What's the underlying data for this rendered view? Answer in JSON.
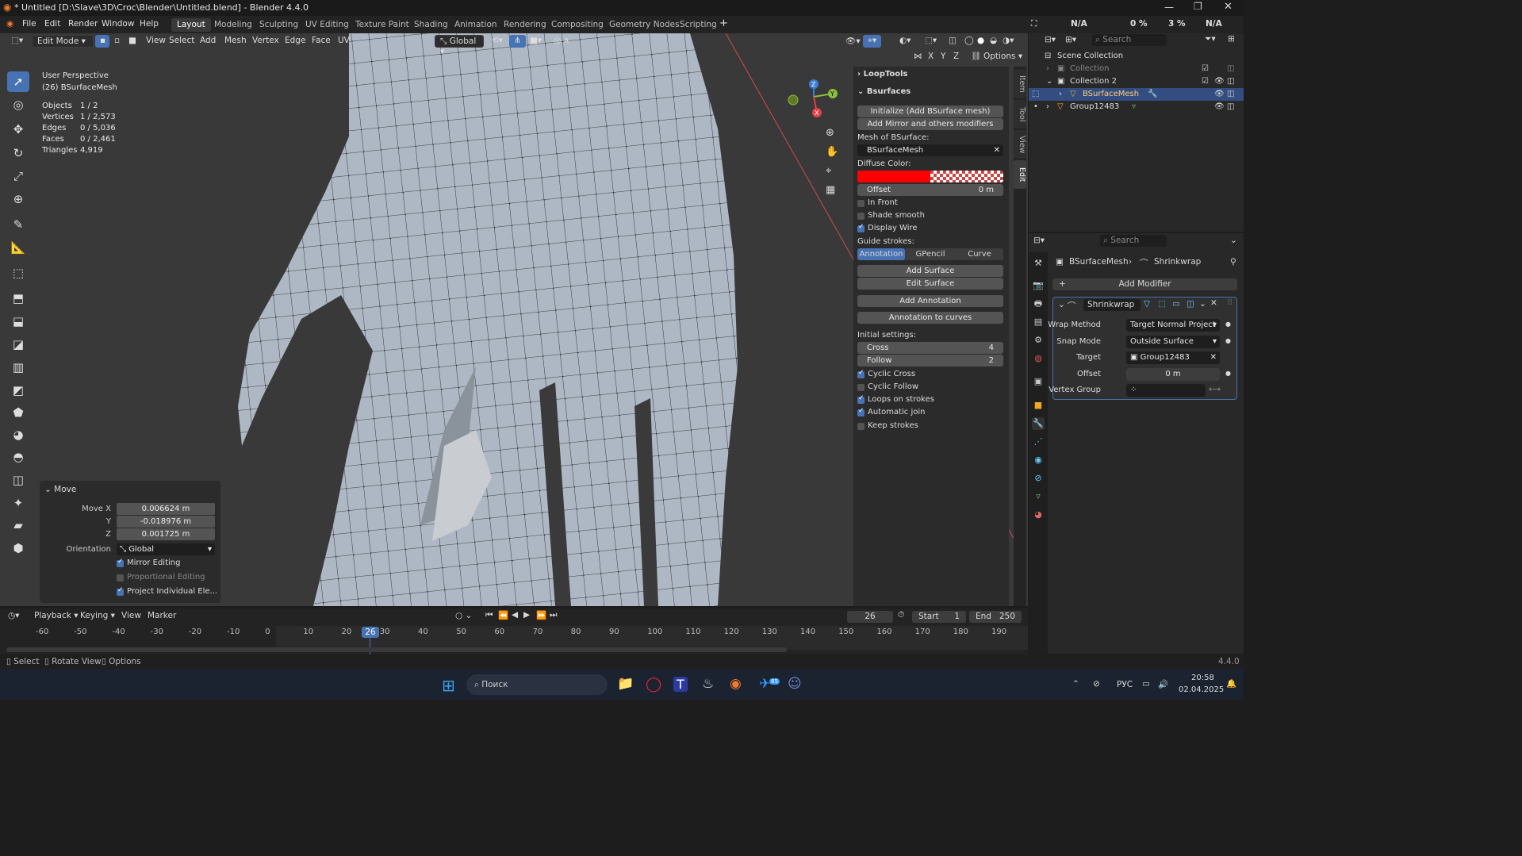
{
  "titlebar": {
    "title": "* Untitled [D:\\Slave\\3D\\Croc\\Blender\\Untitled.blend] - Blender 4.4.0"
  },
  "menu": [
    "File",
    "Edit",
    "Render",
    "Window",
    "Help"
  ],
  "workspaces": [
    "Layout",
    "Modeling",
    "Sculpting",
    "UV Editing",
    "Texture Paint",
    "Shading",
    "Animation",
    "Rendering",
    "Compositing",
    "Geometry Nodes",
    "Scripting"
  ],
  "indicator": {
    "a": "N/A",
    "b": "0 %",
    "c": "3 %",
    "d": "N/A"
  },
  "header": {
    "mode": "Edit Mode",
    "view": "View",
    "select": "Select",
    "add": "Add",
    "mesh": "Mesh",
    "vertex": "Vertex",
    "edge": "Edge",
    "face": "Face",
    "uv": "UV",
    "orientation": "Global",
    "options": "Options"
  },
  "axis": {
    "x": "X",
    "y": "Y",
    "z": "Z"
  },
  "overlay_info": {
    "perspective": "User Perspective",
    "object": "(26) BSurfaceMesh",
    "rows": [
      {
        "k": "Objects",
        "v": "1 / 2"
      },
      {
        "k": "Vertices",
        "v": "1 / 2,573"
      },
      {
        "k": "Edges",
        "v": "0 / 5,036"
      },
      {
        "k": "Faces",
        "v": "0 / 2,461"
      },
      {
        "k": "Triangles",
        "v": "4,919"
      }
    ]
  },
  "npanel": {
    "looptools": "LoopTools",
    "bsurfaces": "Bsurfaces",
    "init_btn": "Initialize (Add BSurface mesh)",
    "mirror_btn": "Add Mirror and others modifiers",
    "mesh_label": "Mesh of BSurface:",
    "mesh_value": "BSurfaceMesh",
    "diffuse_label": "Diffuse Color:",
    "diffuse_color": "#ff0000",
    "offset_label": "Offset",
    "offset_value": "0 m",
    "in_front": "In Front",
    "shade_smooth": "Shade smooth",
    "display_wire": "Display Wire",
    "guide_label": "Guide strokes:",
    "guide_tabs": [
      "Annotation",
      "GPencil",
      "Curve"
    ],
    "add_surface": "Add Surface",
    "edit_surface": "Edit Surface",
    "add_annotation": "Add Annotation",
    "annotation_curves": "Annotation to curves",
    "initial_label": "Initial settings:",
    "cross_label": "Cross",
    "cross_value": "4",
    "follow_label": "Follow",
    "follow_value": "2",
    "cyclic_cross": "Cyclic Cross",
    "cyclic_follow": "Cyclic Follow",
    "loops_on_strokes": "Loops on strokes",
    "automatic_join": "Automatic join",
    "keep_strokes": "Keep strokes"
  },
  "side_tabs": [
    "Item",
    "Tool",
    "View",
    "Edit"
  ],
  "outliner": {
    "search": "Search",
    "scene": "Scene Collection",
    "collection": "Collection",
    "collection2": "Collection 2",
    "bsurface": "BSurfaceMesh",
    "group": "Group12483"
  },
  "props": {
    "search": "Search",
    "breadcrumb_obj": "BSurfaceMesh",
    "breadcrumb_mod": "Shrinkwrap",
    "add_modifier": "Add Modifier",
    "modifier_name": "Shrinkwrap",
    "wrap_label": "Wrap Method",
    "wrap_value": "Target Normal Project",
    "snap_label": "Snap Mode",
    "snap_value": "Outside Surface",
    "target_label": "Target",
    "target_value": "Group12483",
    "offset_label": "Offset",
    "offset_value": "0 m",
    "vgroup_label": "Vertex Group"
  },
  "move": {
    "title": "Move",
    "x_label": "Move X",
    "x": "0.006624 m",
    "y_label": "Y",
    "y": "-0.018976 m",
    "z_label": "Z",
    "z": "0.001725 m",
    "orient_label": "Orientation",
    "orient": "Global",
    "mirror": "Mirror Editing",
    "proportional": "Proportional Editing",
    "project": "Project Individual Ele..."
  },
  "timeline": {
    "playback": "Playback",
    "keying": "Keying",
    "view": "View",
    "marker": "Marker",
    "current": "26",
    "start_label": "Start",
    "start": "1",
    "end_label": "End",
    "end": "250",
    "ticks": [
      "-60",
      "-50",
      "-40",
      "-30",
      "-20",
      "-10",
      "0",
      "10",
      "20",
      "30",
      "40",
      "50",
      "60",
      "70",
      "80",
      "90",
      "100",
      "110",
      "120",
      "130",
      "140",
      "150",
      "160",
      "170",
      "180",
      "190"
    ]
  },
  "status": {
    "select": "Select",
    "rotate": "Rotate View",
    "options": "Options",
    "version": "4.4.0"
  },
  "taskbar": {
    "search": "Поиск",
    "lang": "РУС",
    "time": "20:58",
    "date": "02.04.2025",
    "badge": "65"
  }
}
